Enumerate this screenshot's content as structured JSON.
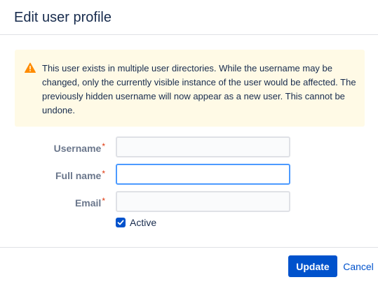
{
  "dialog": {
    "title": "Edit user profile"
  },
  "warning": {
    "icon": "warning-triangle-icon",
    "color": "#ff8b00",
    "background": "#fffae6",
    "message": "This user exists in multiple user directories. While the username may be changed, only the currently visible instance of the user would be affected. The previously hidden username will now appear as a new user. This cannot be undone."
  },
  "form": {
    "username": {
      "label": "Username",
      "required_mark": "*",
      "value": ""
    },
    "full_name": {
      "label": "Full name",
      "required_mark": "*",
      "value": ""
    },
    "email": {
      "label": "Email",
      "required_mark": "*",
      "value": ""
    },
    "active": {
      "label": "Active",
      "checked": true
    }
  },
  "footer": {
    "update_label": "Update",
    "cancel_label": "Cancel"
  },
  "colors": {
    "primary": "#0052cc",
    "focus": "#4c9aff",
    "required": "#de350b"
  }
}
